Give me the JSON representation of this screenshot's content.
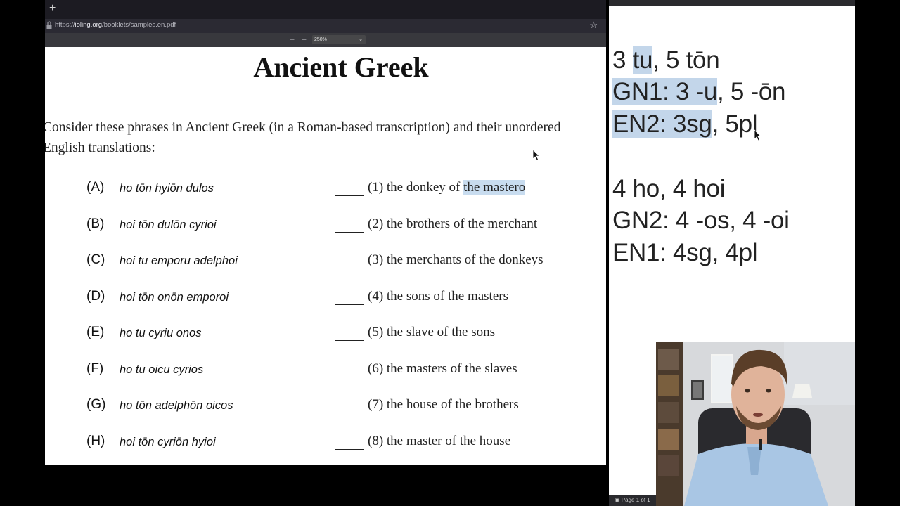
{
  "browser": {
    "new_tab_symbol": "+",
    "url_prefix": "https://",
    "url_host": "ioling.org",
    "url_path": "/booklets/samples.en.pdf",
    "zoom_out": "−",
    "zoom_in": "+",
    "zoom_level": "250%",
    "star_icon": "☆"
  },
  "document": {
    "title": "Ancient Greek",
    "intro_line1": "Consider these phrases in Ancient Greek (in a Roman-based transcription) and their unordered",
    "intro_line2": "English translations:",
    "phrases": [
      {
        "label": "(A)",
        "greek": "ho tōn hyiōn dulos"
      },
      {
        "label": "(B)",
        "greek": "hoi tōn dulōn cyrioi"
      },
      {
        "label": "(C)",
        "greek": "hoi tu emporu adelphoi"
      },
      {
        "label": "(D)",
        "greek": "hoi tōn onōn emporoi"
      },
      {
        "label": "(E)",
        "greek": "ho tu cyriu onos"
      },
      {
        "label": "(F)",
        "greek": "ho tu oicu cyrios"
      },
      {
        "label": "(G)",
        "greek": "ho tōn adelphōn oicos"
      },
      {
        "label": "(H)",
        "greek": "hoi tōn cyriōn hyioi"
      }
    ],
    "translations": [
      {
        "num": "(1)",
        "text": "the donkey of",
        "highlight": "the masterō"
      },
      {
        "num": "(2)",
        "text": "the brothers of the merchant",
        "highlight": ""
      },
      {
        "num": "(3)",
        "text": "the merchants of the donkeys",
        "highlight": ""
      },
      {
        "num": "(4)",
        "text": "the sons of the masters",
        "highlight": ""
      },
      {
        "num": "(5)",
        "text": "the slave of the sons",
        "highlight": ""
      },
      {
        "num": "(6)",
        "text": "the masters of the slaves",
        "highlight": ""
      },
      {
        "num": "(7)",
        "text": "the house of the brothers",
        "highlight": ""
      },
      {
        "num": "(8)",
        "text": "the master of the house",
        "highlight": ""
      }
    ]
  },
  "notes": {
    "line1_a": "3 ",
    "line1_hl": "tu",
    "line1_b": ", 5 tōn",
    "line2_hl1": "GN1: 3 ",
    "line2_hl2": "-u",
    "line2_b": ", 5 -ōn",
    "line3_hl": "EN2: 3sg",
    "line3_b": ", 5pl",
    "line4": "4 ho, 4 hoi",
    "line5": "GN2: 4 -os, 4 -oi",
    "line6": "EN1: 4sg, 4pl",
    "status": "Page 1 of 1"
  },
  "colors": {
    "selection": "#c8dcef",
    "browser_chrome": "#2b2a33"
  }
}
